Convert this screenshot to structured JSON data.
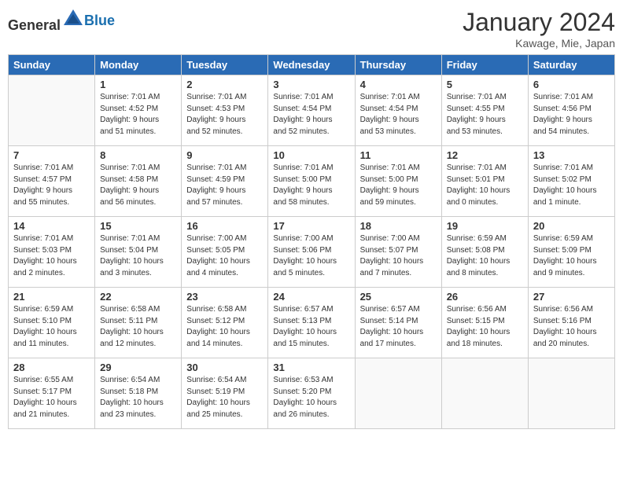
{
  "header": {
    "logo_general": "General",
    "logo_blue": "Blue",
    "month_title": "January 2024",
    "location": "Kawage, Mie, Japan"
  },
  "days_of_week": [
    "Sunday",
    "Monday",
    "Tuesday",
    "Wednesday",
    "Thursday",
    "Friday",
    "Saturday"
  ],
  "weeks": [
    [
      {
        "date": "",
        "info": ""
      },
      {
        "date": "1",
        "info": "Sunrise: 7:01 AM\nSunset: 4:52 PM\nDaylight: 9 hours\nand 51 minutes."
      },
      {
        "date": "2",
        "info": "Sunrise: 7:01 AM\nSunset: 4:53 PM\nDaylight: 9 hours\nand 52 minutes."
      },
      {
        "date": "3",
        "info": "Sunrise: 7:01 AM\nSunset: 4:54 PM\nDaylight: 9 hours\nand 52 minutes."
      },
      {
        "date": "4",
        "info": "Sunrise: 7:01 AM\nSunset: 4:54 PM\nDaylight: 9 hours\nand 53 minutes."
      },
      {
        "date": "5",
        "info": "Sunrise: 7:01 AM\nSunset: 4:55 PM\nDaylight: 9 hours\nand 53 minutes."
      },
      {
        "date": "6",
        "info": "Sunrise: 7:01 AM\nSunset: 4:56 PM\nDaylight: 9 hours\nand 54 minutes."
      }
    ],
    [
      {
        "date": "7",
        "info": "Sunrise: 7:01 AM\nSunset: 4:57 PM\nDaylight: 9 hours\nand 55 minutes."
      },
      {
        "date": "8",
        "info": "Sunrise: 7:01 AM\nSunset: 4:58 PM\nDaylight: 9 hours\nand 56 minutes."
      },
      {
        "date": "9",
        "info": "Sunrise: 7:01 AM\nSunset: 4:59 PM\nDaylight: 9 hours\nand 57 minutes."
      },
      {
        "date": "10",
        "info": "Sunrise: 7:01 AM\nSunset: 5:00 PM\nDaylight: 9 hours\nand 58 minutes."
      },
      {
        "date": "11",
        "info": "Sunrise: 7:01 AM\nSunset: 5:00 PM\nDaylight: 9 hours\nand 59 minutes."
      },
      {
        "date": "12",
        "info": "Sunrise: 7:01 AM\nSunset: 5:01 PM\nDaylight: 10 hours\nand 0 minutes."
      },
      {
        "date": "13",
        "info": "Sunrise: 7:01 AM\nSunset: 5:02 PM\nDaylight: 10 hours\nand 1 minute."
      }
    ],
    [
      {
        "date": "14",
        "info": "Sunrise: 7:01 AM\nSunset: 5:03 PM\nDaylight: 10 hours\nand 2 minutes."
      },
      {
        "date": "15",
        "info": "Sunrise: 7:01 AM\nSunset: 5:04 PM\nDaylight: 10 hours\nand 3 minutes."
      },
      {
        "date": "16",
        "info": "Sunrise: 7:00 AM\nSunset: 5:05 PM\nDaylight: 10 hours\nand 4 minutes."
      },
      {
        "date": "17",
        "info": "Sunrise: 7:00 AM\nSunset: 5:06 PM\nDaylight: 10 hours\nand 5 minutes."
      },
      {
        "date": "18",
        "info": "Sunrise: 7:00 AM\nSunset: 5:07 PM\nDaylight: 10 hours\nand 7 minutes."
      },
      {
        "date": "19",
        "info": "Sunrise: 6:59 AM\nSunset: 5:08 PM\nDaylight: 10 hours\nand 8 minutes."
      },
      {
        "date": "20",
        "info": "Sunrise: 6:59 AM\nSunset: 5:09 PM\nDaylight: 10 hours\nand 9 minutes."
      }
    ],
    [
      {
        "date": "21",
        "info": "Sunrise: 6:59 AM\nSunset: 5:10 PM\nDaylight: 10 hours\nand 11 minutes."
      },
      {
        "date": "22",
        "info": "Sunrise: 6:58 AM\nSunset: 5:11 PM\nDaylight: 10 hours\nand 12 minutes."
      },
      {
        "date": "23",
        "info": "Sunrise: 6:58 AM\nSunset: 5:12 PM\nDaylight: 10 hours\nand 14 minutes."
      },
      {
        "date": "24",
        "info": "Sunrise: 6:57 AM\nSunset: 5:13 PM\nDaylight: 10 hours\nand 15 minutes."
      },
      {
        "date": "25",
        "info": "Sunrise: 6:57 AM\nSunset: 5:14 PM\nDaylight: 10 hours\nand 17 minutes."
      },
      {
        "date": "26",
        "info": "Sunrise: 6:56 AM\nSunset: 5:15 PM\nDaylight: 10 hours\nand 18 minutes."
      },
      {
        "date": "27",
        "info": "Sunrise: 6:56 AM\nSunset: 5:16 PM\nDaylight: 10 hours\nand 20 minutes."
      }
    ],
    [
      {
        "date": "28",
        "info": "Sunrise: 6:55 AM\nSunset: 5:17 PM\nDaylight: 10 hours\nand 21 minutes."
      },
      {
        "date": "29",
        "info": "Sunrise: 6:54 AM\nSunset: 5:18 PM\nDaylight: 10 hours\nand 23 minutes."
      },
      {
        "date": "30",
        "info": "Sunrise: 6:54 AM\nSunset: 5:19 PM\nDaylight: 10 hours\nand 25 minutes."
      },
      {
        "date": "31",
        "info": "Sunrise: 6:53 AM\nSunset: 5:20 PM\nDaylight: 10 hours\nand 26 minutes."
      },
      {
        "date": "",
        "info": ""
      },
      {
        "date": "",
        "info": ""
      },
      {
        "date": "",
        "info": ""
      }
    ]
  ]
}
